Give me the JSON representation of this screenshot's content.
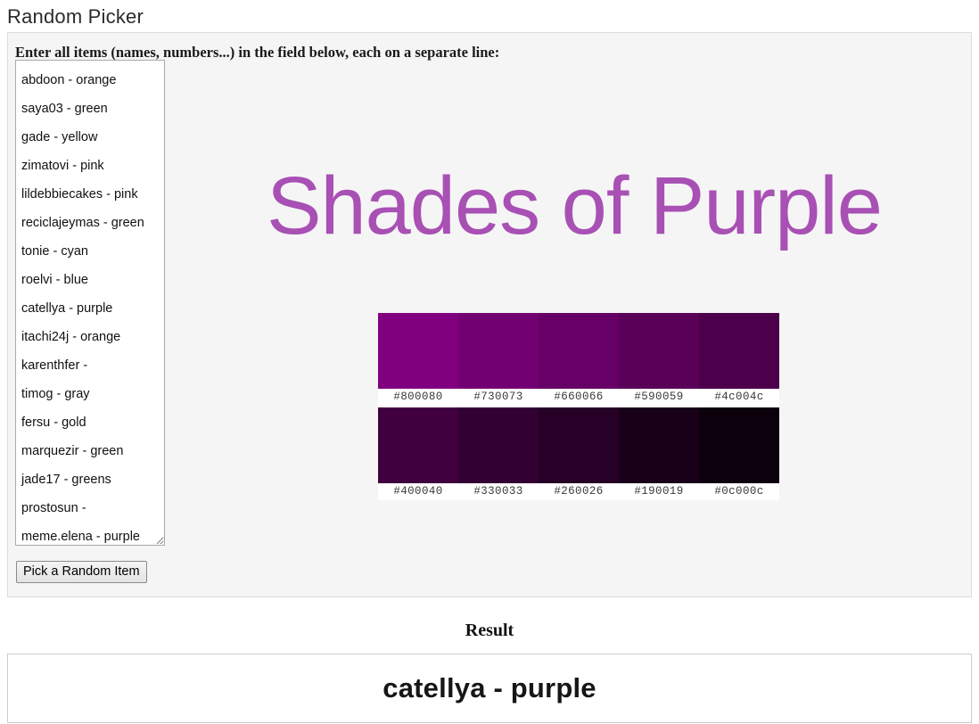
{
  "page": {
    "title": "Random Picker"
  },
  "form": {
    "instruction": "Enter all items (names, numbers...) in the field below, each on a separate line:",
    "items_value": "abdoon - orange\nsaya03 - green\ngade - yellow\nzimatovi - pink\nlildebbiecakes - pink\nreciclajeymas - green\ntonie - cyan\nroelvi - blue\ncatellya - purple\nitachi24j - orange\nkarenthfer -\ntimog - gray\nfersu - gold\nmarquezir - green\njade17 - greens\nprostosun -\nmeme.elena - purple",
    "items_placeholder": "",
    "pick_button_label": "Pick a Random Item"
  },
  "showcase": {
    "title": "Shades of Purple",
    "title_color": "#a850b4",
    "rows": [
      {
        "swatches": [
          {
            "hex": "#800080",
            "label": "#800080"
          },
          {
            "hex": "#730073",
            "label": "#730073"
          },
          {
            "hex": "#660066",
            "label": "#660066"
          },
          {
            "hex": "#590059",
            "label": "#590059"
          },
          {
            "hex": "#4c004c",
            "label": "#4c004c"
          }
        ]
      },
      {
        "swatches": [
          {
            "hex": "#400040",
            "label": "#400040"
          },
          {
            "hex": "#330033",
            "label": "#330033"
          },
          {
            "hex": "#260026",
            "label": "#260026"
          },
          {
            "hex": "#190019",
            "label": "#190019"
          },
          {
            "hex": "#0c000c",
            "label": "#0c000c"
          }
        ]
      }
    ]
  },
  "result": {
    "heading": "Result",
    "value": "catellya - purple"
  }
}
